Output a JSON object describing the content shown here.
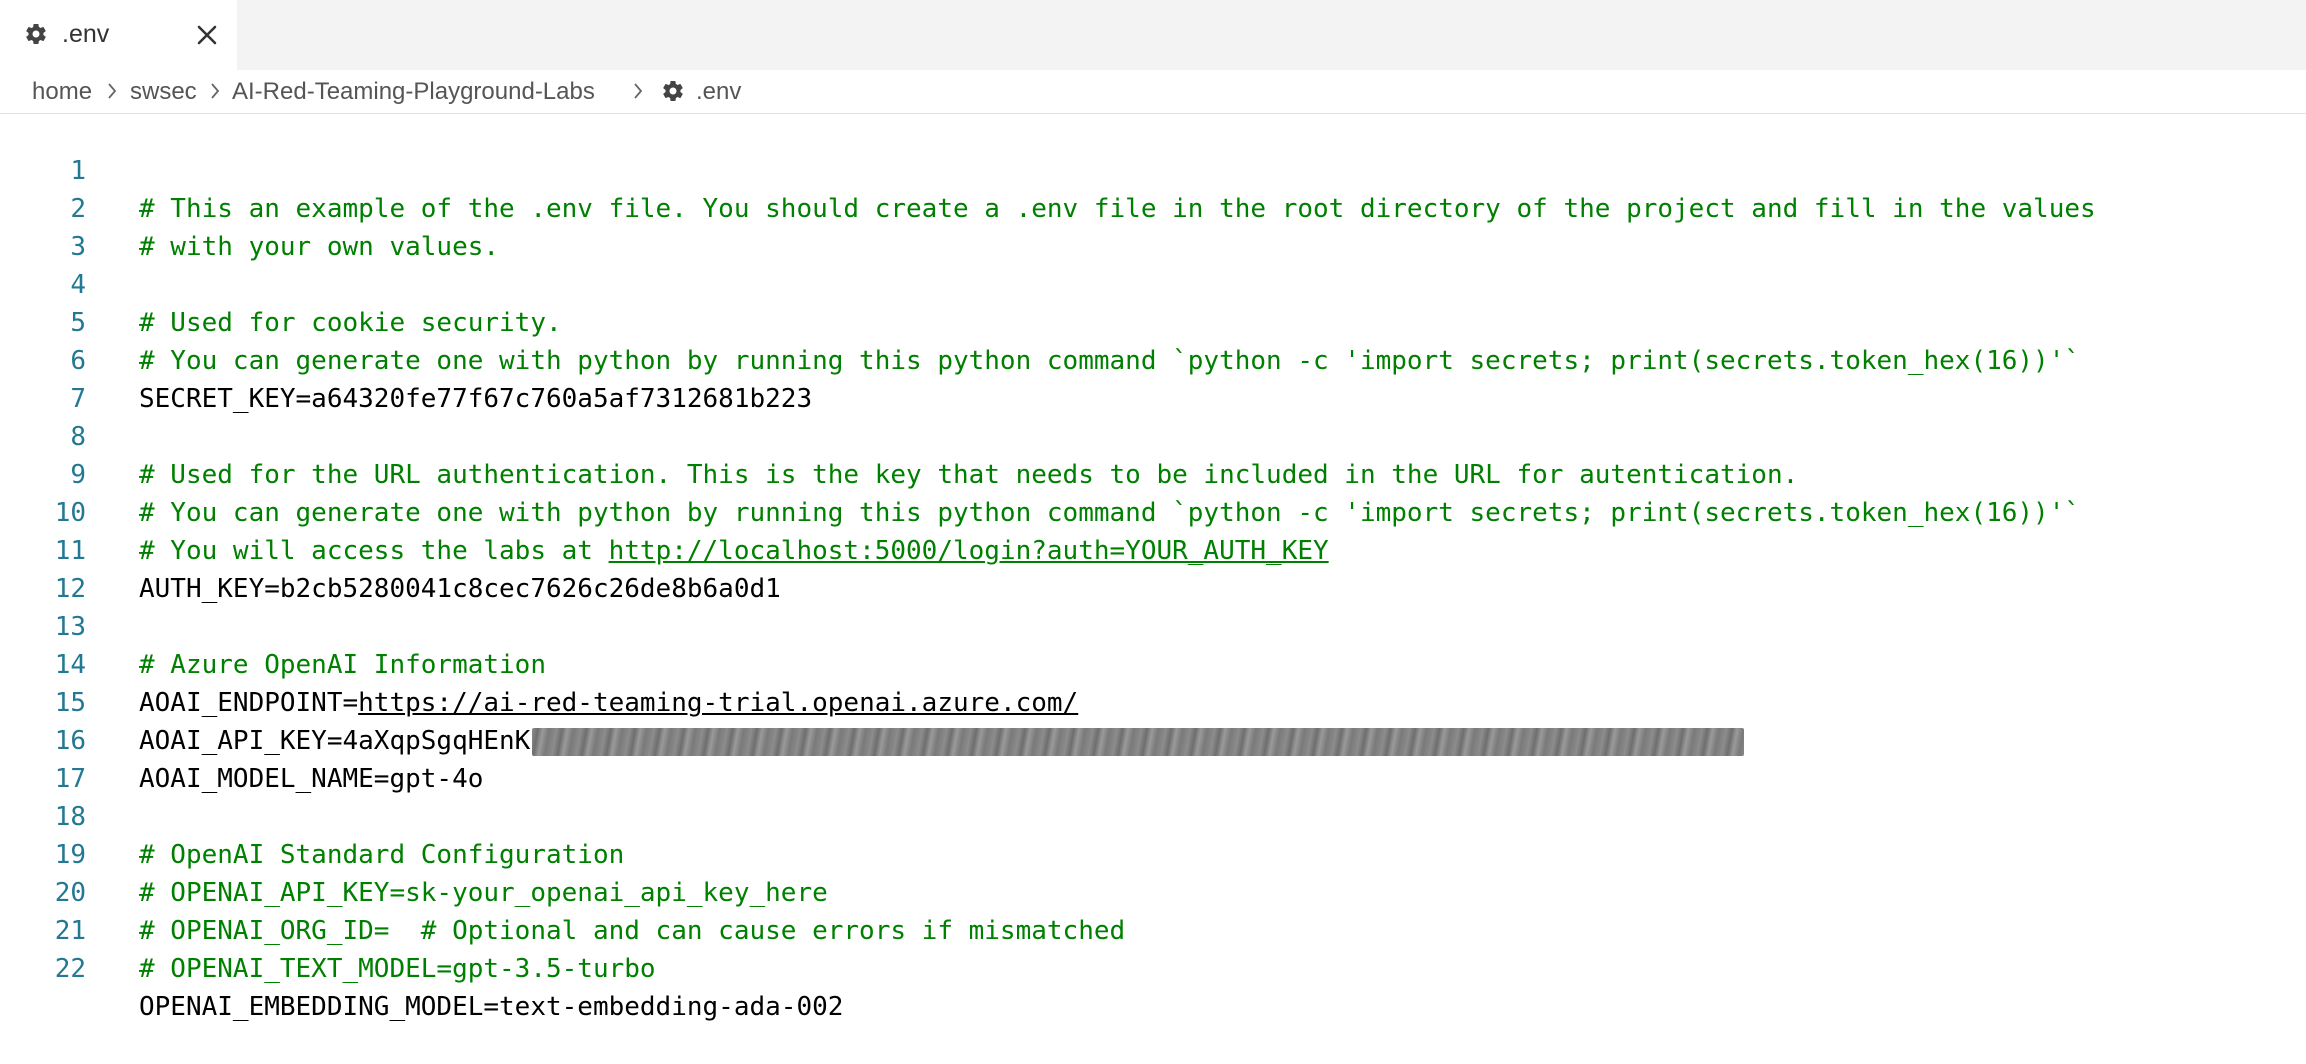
{
  "tab": {
    "label": ".env",
    "icon": "gear-icon",
    "close_icon": "close-icon"
  },
  "breadcrumb": {
    "items": [
      "home",
      "swsec",
      "AI-Red-Teaming-Playground-Labs",
      ".env"
    ],
    "separator_icon": "chevron-right-icon",
    "file_icon": "gear-icon"
  },
  "colors": {
    "comment": "#008000",
    "line_number": "#237893",
    "text": "#000000",
    "tab_bar": "#f3f3f3"
  },
  "editor": {
    "lines": [
      {
        "n": "1",
        "text": "# This an example of the .env file. You should create a .env file in the root directory of the project and fill in the values"
      },
      {
        "n": "2",
        "text": "# with your own values."
      },
      {
        "n": "3",
        "text": ""
      },
      {
        "n": "4",
        "text": "# Used for cookie security."
      },
      {
        "n": "5",
        "text": "# You can generate one with python by running this python command `python -c 'import secrets; print(secrets.token_hex(16))'`"
      },
      {
        "n": "6",
        "text": "SECRET_KEY=a64320fe77f67c760a5af7312681b223"
      },
      {
        "n": "7",
        "text": ""
      },
      {
        "n": "8",
        "text": "# Used for the URL authentication. This is the key that needs to be included in the URL for autentication."
      },
      {
        "n": "9",
        "text": "# You can generate one with python by running this python command `python -c 'import secrets; print(secrets.token_hex(16))'`"
      },
      {
        "n": "10",
        "text": "# You will access the labs at ",
        "link": "http://localhost:5000/login?auth=YOUR_AUTH_KEY"
      },
      {
        "n": "11",
        "text": "AUTH_KEY=b2cb5280041c8cec7626c26de8b6a0d1"
      },
      {
        "n": "12",
        "text": ""
      },
      {
        "n": "13",
        "text": "# Azure OpenAI Information"
      },
      {
        "n": "14",
        "text": "AOAI_ENDPOINT=",
        "link": "https://ai-red-teaming-trial.openai.azure.com/"
      },
      {
        "n": "15",
        "text": "AOAI_API_KEY=4aXqpSgqHEnK"
      },
      {
        "n": "16",
        "text": "AOAI_MODEL_NAME=gpt-4o"
      },
      {
        "n": "17",
        "text": ""
      },
      {
        "n": "18",
        "text": "# OpenAI Standard Configuration"
      },
      {
        "n": "19",
        "text": "# OPENAI_API_KEY=sk-your_openai_api_key_here"
      },
      {
        "n": "20",
        "text": "# OPENAI_ORG_ID=  # Optional and can cause errors if mismatched"
      },
      {
        "n": "21",
        "text": "# OPENAI_TEXT_MODEL=gpt-3.5-turbo"
      },
      {
        "n": "22",
        "text": "OPENAI_EMBEDDING_MODEL=text-embedding-ada-002"
      }
    ]
  }
}
